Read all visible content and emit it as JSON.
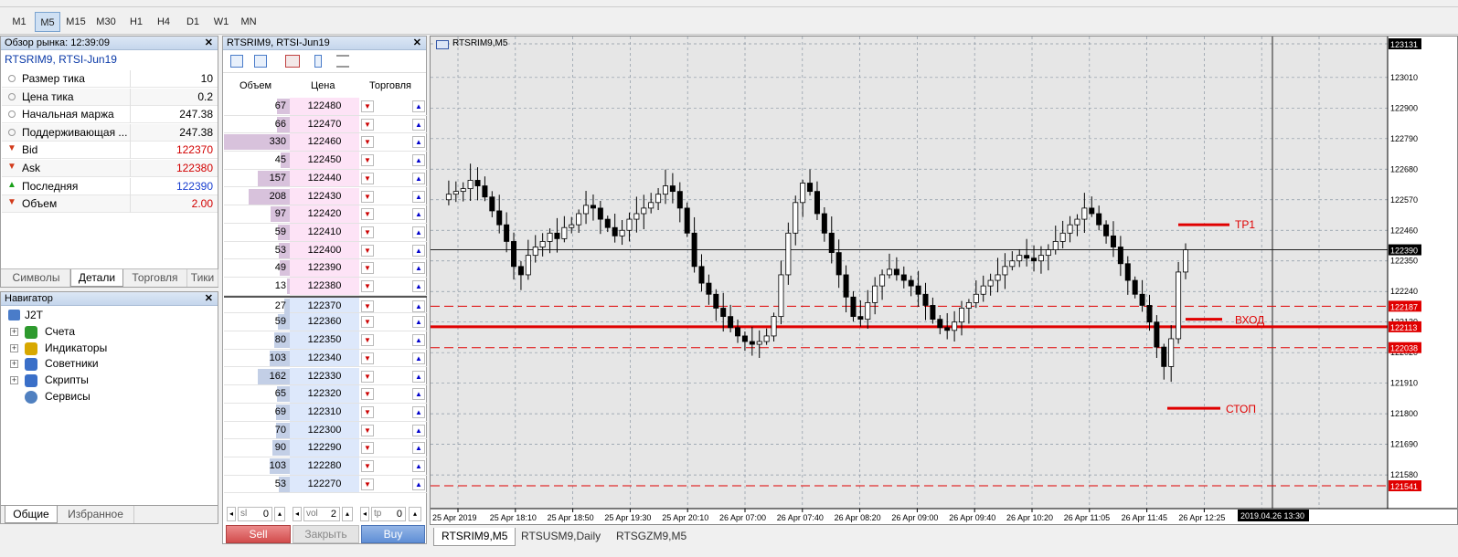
{
  "timeframes": [
    "M1",
    "M5",
    "M15",
    "M30",
    "H1",
    "H4",
    "D1",
    "W1",
    "MN"
  ],
  "active_timeframe": "M5",
  "market_watch": {
    "title": "Обзор рынка: 12:39:09",
    "symbol": "RTSRIM9, RTSI-Jun19",
    "rows": [
      {
        "label": "Размер тика",
        "value": "10",
        "icon": "circle-icon",
        "color": "#000000"
      },
      {
        "label": "Цена тика",
        "value": "0.2",
        "icon": "circle-icon",
        "color": "#000000"
      },
      {
        "label": "Начальная маржа",
        "value": "247.38",
        "icon": "circle-icon",
        "color": "#000000"
      },
      {
        "label": "Поддерживающая ...",
        "value": "247.38",
        "icon": "circle-icon",
        "color": "#000000"
      },
      {
        "label": "Bid",
        "value": "122370",
        "icon": "arrow-down-icon",
        "color": "#d20000"
      },
      {
        "label": "Ask",
        "value": "122380",
        "icon": "arrow-down-icon",
        "color": "#d20000"
      },
      {
        "label": "Последняя",
        "value": "122390",
        "icon": "arrow-up-icon",
        "color": "#1a3fd0"
      },
      {
        "label": "Объем",
        "value": "2.00",
        "icon": "arrow-down-icon",
        "color": "#d20000"
      }
    ],
    "tabs": [
      "Символы",
      "Детали",
      "Торговля",
      "Тики"
    ],
    "active_tab": "Детали"
  },
  "navigator": {
    "title": "Навигатор",
    "root": "J2T",
    "items": [
      "Счета",
      "Индикаторы",
      "Советники",
      "Скрипты",
      "Сервисы"
    ],
    "tabs": [
      "Общие",
      "Избранное"
    ],
    "active_tab": "Общие"
  },
  "depth": {
    "title": "RTSRIM9, RTSI-Jun19",
    "headers": [
      "Объем",
      "Цена",
      "Торговля"
    ],
    "rows": [
      {
        "vol": "67",
        "price": "122480",
        "side": "ask",
        "level": 0.2
      },
      {
        "vol": "66",
        "price": "122470",
        "side": "ask",
        "level": 0.2
      },
      {
        "vol": "330",
        "price": "122460",
        "side": "ask",
        "level": 1.0
      },
      {
        "vol": "45",
        "price": "122450",
        "side": "ask",
        "level": 0.14
      },
      {
        "vol": "157",
        "price": "122440",
        "side": "ask",
        "level": 0.48
      },
      {
        "vol": "208",
        "price": "122430",
        "side": "ask",
        "level": 0.63
      },
      {
        "vol": "97",
        "price": "122420",
        "side": "ask",
        "level": 0.29
      },
      {
        "vol": "59",
        "price": "122410",
        "side": "ask",
        "level": 0.18
      },
      {
        "vol": "53",
        "price": "122400",
        "side": "ask",
        "level": 0.16
      },
      {
        "vol": "49",
        "price": "122390",
        "side": "ask",
        "level": 0.15
      },
      {
        "vol": "13",
        "price": "122380",
        "side": "ask",
        "level": 0.04
      },
      {
        "vol": "27",
        "price": "122370",
        "side": "bid",
        "level": 0.08
      },
      {
        "vol": "59",
        "price": "122360",
        "side": "bid",
        "level": 0.18
      },
      {
        "vol": "80",
        "price": "122350",
        "side": "bid",
        "level": 0.24
      },
      {
        "vol": "103",
        "price": "122340",
        "side": "bid",
        "level": 0.31
      },
      {
        "vol": "162",
        "price": "122330",
        "side": "bid",
        "level": 0.49
      },
      {
        "vol": "65",
        "price": "122320",
        "side": "bid",
        "level": 0.2
      },
      {
        "vol": "69",
        "price": "122310",
        "side": "bid",
        "level": 0.21
      },
      {
        "vol": "70",
        "price": "122300",
        "side": "bid",
        "level": 0.21
      },
      {
        "vol": "90",
        "price": "122290",
        "side": "bid",
        "level": 0.27
      },
      {
        "vol": "103",
        "price": "122280",
        "side": "bid",
        "level": 0.31
      },
      {
        "vol": "53",
        "price": "122270",
        "side": "bid",
        "level": 0.16
      }
    ],
    "sl_label": "sl",
    "sl_value": "0",
    "vol_label": "vol",
    "vol_value": "2",
    "tp_label": "tp",
    "tp_value": "0",
    "sell_label": "Sell",
    "close_label": "Закрыть",
    "buy_label": "Buy"
  },
  "chart": {
    "title": "RTSRIM9,M5",
    "price_labels": [
      "123131",
      "123010",
      "122900",
      "122790",
      "122680",
      "122570",
      "122460",
      "122350",
      "122240",
      "122130",
      "122020",
      "121910",
      "121800",
      "121690",
      "121580"
    ],
    "current_price": "122390",
    "level_labels": [
      {
        "text": "122187",
        "value": 122187
      },
      {
        "text": "122113",
        "value": 122113
      },
      {
        "text": "122038",
        "value": 122038
      },
      {
        "text": "121541",
        "value": 121541
      }
    ],
    "time_labels": [
      "25 Apr 2019",
      "25 Apr 18:10",
      "25 Apr 18:50",
      "25 Apr 19:30",
      "25 Apr 20:10",
      "26 Apr 07:00",
      "26 Apr 07:40",
      "26 Apr 08:20",
      "26 Apr 09:00",
      "26 Apr 09:40",
      "26 Apr 10:20",
      "26 Apr 11:05",
      "26 Apr 11:45",
      "26 Apr 12:25"
    ],
    "crosshair_time": "2019.04.26 13:30",
    "annotations": [
      "TP1",
      "ВХОД",
      "СТОП"
    ],
    "tabs": [
      "RTSRIM9,M5",
      "RTSUSM9,Daily",
      "RTSGZM9,M5"
    ],
    "active_tab": "RTSRIM9,M5",
    "colors": {
      "bg": "#ffffff",
      "plot": "#ffffff",
      "grid": "#8c9aa8",
      "level": "#e00000",
      "candle": "#000000"
    }
  }
}
